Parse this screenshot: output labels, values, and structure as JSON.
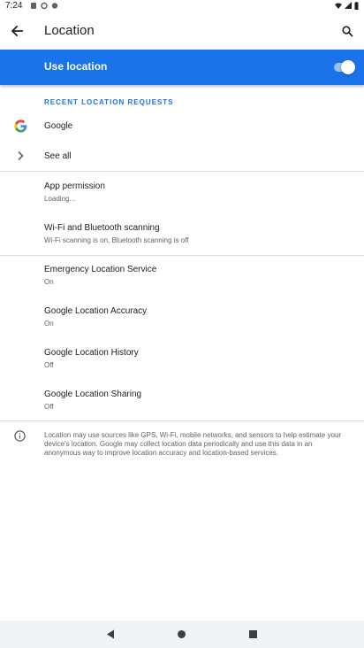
{
  "status_bar": {
    "time": "7:24",
    "left_icons": [
      "notification-icon",
      "settings-notification-icon",
      "sync-icon"
    ],
    "right_icons": [
      "wifi-icon",
      "signal-icon",
      "battery-icon"
    ]
  },
  "toolbar": {
    "title": "Location",
    "back_icon": "arrow-back-icon",
    "search_icon": "search-icon"
  },
  "use_location": {
    "label": "Use location",
    "enabled": true
  },
  "recent_requests": {
    "header": "RECENT LOCATION REQUESTS",
    "items": [
      {
        "label": "Google",
        "icon": "google-logo-icon"
      }
    ],
    "see_all": "See all"
  },
  "settings": [
    {
      "title": "App permission",
      "subtitle": "Loading..."
    },
    {
      "title": "Wi-Fi and Bluetooth scanning",
      "subtitle": "Wi-Fi scanning is on, Bluetooth scanning is off"
    },
    {
      "title": "Emergency Location Service",
      "subtitle": "On"
    },
    {
      "title": "Google Location Accuracy",
      "subtitle": "On"
    },
    {
      "title": "Google Location History",
      "subtitle": "Off"
    },
    {
      "title": "Google Location Sharing",
      "subtitle": "Off"
    }
  ],
  "footer_info": {
    "icon": "info-icon",
    "text": "Location may use sources like GPS, Wi-Fi, mobile networks, and sensors to help estimate your device's location. Google may collect location data periodically and use this data in an anonymous way to improve location accuracy and location-based services."
  },
  "colors": {
    "accent": "#1a73e8",
    "divider": "#dadce0",
    "secondary_text": "#5f6368"
  }
}
